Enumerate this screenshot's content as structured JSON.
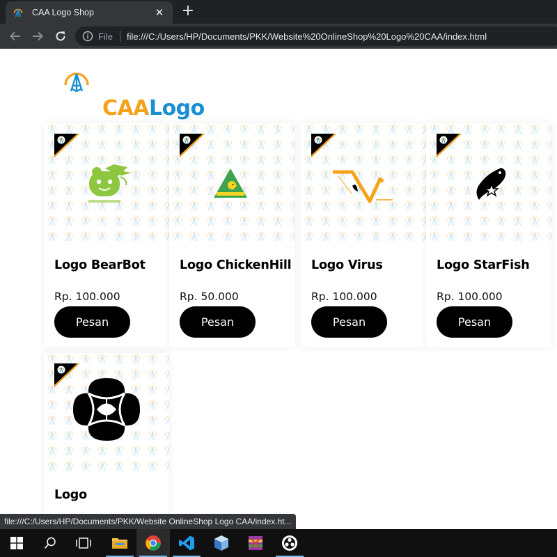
{
  "browser": {
    "tab": {
      "title": "CAA Logo Shop",
      "favicon": "caa-logo-icon",
      "close_glyph": "✕"
    },
    "new_tab_glyph": "+",
    "omnibox": {
      "scheme_label": "File",
      "url": "file:///C:/Users/HP/Documents/PKK/Website%20OnlineShop%20Logo%20CAA/index.html"
    },
    "status_url": "file:///C:/Users/HP/Documents/PKK/Website OnlineShop Logo CAA/index.ht..."
  },
  "brand": {
    "name_part1": "CAA",
    "name_part2": "Logo",
    "color_part1": "#f5a21b",
    "color_part2": "#1b8fd0"
  },
  "products": [
    {
      "title": "Logo BearBot",
      "price": "Rp. 100.000",
      "button": "Pesan",
      "image_icon": "bearbot-logo"
    },
    {
      "title": "Logo ChickenHill",
      "price": "Rp. 50.000",
      "button": "Pesan",
      "image_icon": "chickenhill-logo"
    },
    {
      "title": "Logo Virus",
      "price": "Rp. 100.000",
      "button": "Pesan",
      "image_icon": "virus-logo"
    },
    {
      "title": "Logo StarFish",
      "price": "Rp. 100.000",
      "button": "Pesan",
      "image_icon": "starfish-logo"
    },
    {
      "title": "Logo",
      "price": "",
      "button": "",
      "image_icon": "flower-logo"
    }
  ],
  "taskbar": {
    "items": [
      "start-icon",
      "search-icon",
      "task-view-icon",
      "file-explorer-icon",
      "chrome-icon",
      "vscode-icon",
      "virtualbox-icon",
      "winrar-icon",
      "obs-icon"
    ],
    "active": "chrome-icon"
  },
  "colors": {
    "accent_orange": "#f5a21b",
    "accent_blue": "#1b8fd0",
    "chrome_dark": "#202124",
    "chrome_mid": "#35363a"
  }
}
